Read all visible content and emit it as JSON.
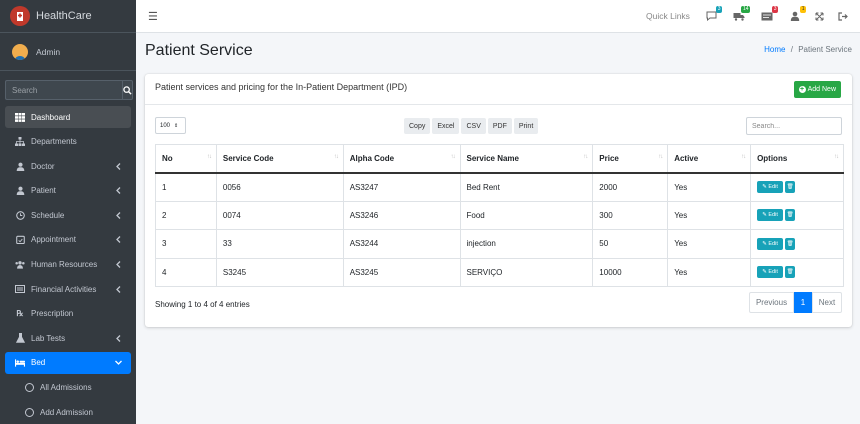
{
  "app": {
    "name": "HealthCare"
  },
  "user": {
    "name": "Admin"
  },
  "sidebar": {
    "search_placeholder": "Search",
    "items": [
      {
        "label": "Dashboard",
        "icon": "grid-icon",
        "arrow": false
      },
      {
        "label": "Departments",
        "icon": "sitemap-icon",
        "arrow": false
      },
      {
        "label": "Doctor",
        "icon": "user-md-icon",
        "arrow": true
      },
      {
        "label": "Patient",
        "icon": "user-icon",
        "arrow": true
      },
      {
        "label": "Schedule",
        "icon": "clock-icon",
        "arrow": true
      },
      {
        "label": "Appointment",
        "icon": "calendar-check-icon",
        "arrow": true
      },
      {
        "label": "Human Resources",
        "icon": "users-icon",
        "arrow": true
      },
      {
        "label": "Financial Activities",
        "icon": "money-icon",
        "arrow": true
      },
      {
        "label": "Prescription",
        "icon": "prescription-icon",
        "arrow": false
      },
      {
        "label": "Lab Tests",
        "icon": "flask-icon",
        "arrow": true
      },
      {
        "label": "Bed",
        "icon": "bed-icon",
        "arrow": true
      }
    ],
    "sub_items": [
      "All Admissions",
      "Add Admission"
    ]
  },
  "topbar": {
    "quick_links": "Quick Links",
    "badges": [
      "3",
      "14",
      "3",
      "1"
    ]
  },
  "page": {
    "title": "Patient Service",
    "breadcrumb_home": "Home",
    "breadcrumb_sep": "/",
    "breadcrumb_current": "Patient Service"
  },
  "card": {
    "title": "Patient services and pricing for the In-Patient Department (IPD)",
    "add_label": "Add New",
    "page_length": "100",
    "export_buttons": [
      "Copy",
      "Excel",
      "CSV",
      "PDF",
      "Print"
    ],
    "search_placeholder": "Search..."
  },
  "table": {
    "headers": [
      "No",
      "Service Code",
      "Alpha Code",
      "Service Name",
      "Price",
      "Active",
      "Options"
    ],
    "rows": [
      [
        "1",
        "0056",
        "AS3247",
        "Bed Rent",
        "2000",
        "Yes"
      ],
      [
        "2",
        "0074",
        "AS3246",
        "Food",
        "300",
        "Yes"
      ],
      [
        "3",
        "33",
        "AS3244",
        "injection",
        "50",
        "Yes"
      ],
      [
        "4",
        "S3245",
        "AS3245",
        "SERVIÇO",
        "10000",
        "Yes"
      ]
    ],
    "edit_label": "Edit"
  },
  "footer": {
    "info": "Showing 1 to 4 of 4 entries",
    "prev": "Previous",
    "current_page": "1",
    "next": "Next"
  },
  "colors": {
    "sidebar_bg": "#343a40",
    "primary": "#007bff",
    "success": "#28a745",
    "info": "#17a2b8"
  }
}
